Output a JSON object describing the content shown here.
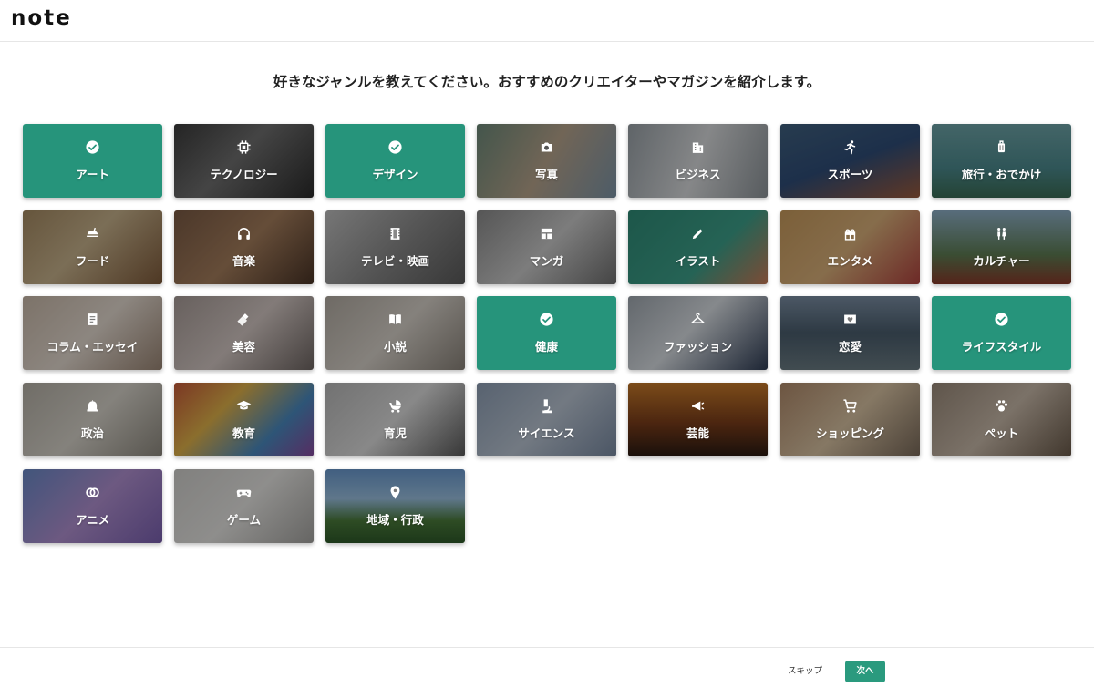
{
  "app": {
    "logo": "note"
  },
  "heading": "好きなジャンルを教えてください。おすすめのクリエイターやマガジンを紹介します。",
  "genres": [
    {
      "label": "アート",
      "icon": "check-icon",
      "selected": true,
      "bg": "#26947b"
    },
    {
      "label": "テクノロジー",
      "icon": "chip-icon",
      "selected": false,
      "bg": "linear-gradient(135deg,#3b3b3b,#6f6f6f 45%,#2b2b2b)"
    },
    {
      "label": "デザイン",
      "icon": "check-icon",
      "selected": true,
      "bg": "#26947b"
    },
    {
      "label": "写真",
      "icon": "camera-icon",
      "selected": false,
      "bg": "linear-gradient(120deg,#6d8a7a,#b7a48c 50%,#7d95a8)"
    },
    {
      "label": "ビジネス",
      "icon": "building-icon",
      "selected": false,
      "bg": "linear-gradient(110deg,#9aa2a8,#d8dadc 50%,#8d9499)"
    },
    {
      "label": "スポーツ",
      "icon": "runner-icon",
      "selected": false,
      "bg": "linear-gradient(160deg,#40617f,#2f4d78 50%,#9b5a3c)"
    },
    {
      "label": "旅行・おでかけ",
      "icon": "luggage-icon",
      "selected": false,
      "bg": "linear-gradient(180deg,#6ea4a8,#4c8a8e 60%,#3b6d55)"
    },
    {
      "label": "フード",
      "icon": "food-icon",
      "selected": false,
      "bg": "linear-gradient(135deg,#a58a62,#c7b28c 45%,#7e5a3a)"
    },
    {
      "label": "音楽",
      "icon": "headphones-icon",
      "selected": false,
      "bg": "linear-gradient(135deg,#7a5a44,#a47d5c 50%,#4a3426)"
    },
    {
      "label": "テレビ・映画",
      "icon": "film-icon",
      "selected": false,
      "bg": "linear-gradient(135deg,#bfbfbf,#8a8a8a 50%,#5a5a5a)"
    },
    {
      "label": "マンガ",
      "icon": "manga-icon",
      "selected": false,
      "bg": "linear-gradient(135deg,#8a8a8a,#c9c9c9 50%,#6f6f6f)"
    },
    {
      "label": "イラスト",
      "icon": "pencil-icon",
      "selected": false,
      "bg": "linear-gradient(135deg,#2f8c77,#3da08a 60%,#c97a56)"
    },
    {
      "label": "エンタメ",
      "icon": "gift-icon",
      "selected": false,
      "bg": "linear-gradient(135deg,#c79a5c,#d9b07a 50%,#b0433f)"
    },
    {
      "label": "カルチャー",
      "icon": "family-icon",
      "selected": false,
      "bg": "linear-gradient(180deg,#8fb0c8,#5e7d53 60%,#8a3a2a)"
    },
    {
      "label": "コラム・エッセイ",
      "icon": "document-icon",
      "selected": false,
      "bg": "linear-gradient(135deg,#c9b9a9,#e3d9cf 50%,#9a8574)"
    },
    {
      "label": "美容",
      "icon": "lipstick-icon",
      "selected": false,
      "bg": "linear-gradient(135deg,#a89c98,#d3c7c3 50%,#6f6663)"
    },
    {
      "label": "小説",
      "icon": "book-icon",
      "selected": false,
      "bg": "linear-gradient(135deg,#b3aca3,#d7d1c9 50%,#8a837a)"
    },
    {
      "label": "健康",
      "icon": "check-icon",
      "selected": true,
      "bg": "#26947b"
    },
    {
      "label": "ファッション",
      "icon": "hanger-icon",
      "selected": false,
      "bg": "linear-gradient(135deg,#a0a8b0,#d8dde2 45%,#2f3d55)"
    },
    {
      "label": "恋愛",
      "icon": "heart-mail-icon",
      "selected": false,
      "bg": "linear-gradient(180deg,#7b8ea3,#4a5d6d 50%,#6a7b82)"
    },
    {
      "label": "ライフスタイル",
      "icon": "check-icon",
      "selected": true,
      "bg": "#26947b"
    },
    {
      "label": "政治",
      "icon": "capitol-icon",
      "selected": false,
      "bg": "linear-gradient(135deg,#b5b0a6,#d6d2c9 50%,#8e897f)"
    },
    {
      "label": "教育",
      "icon": "graduation-cap-icon",
      "selected": false,
      "bg": "linear-gradient(135deg,#c85a3a,#e0b24a 35%,#4a8ac0 70%,#8a4aa0)"
    },
    {
      "label": "育児",
      "icon": "stroller-icon",
      "selected": false,
      "bg": "linear-gradient(135deg,#b8b8b8,#dcdcdc 50%,#5a5a5a)"
    },
    {
      "label": "サイエンス",
      "icon": "microscope-icon",
      "selected": false,
      "bg": "linear-gradient(135deg,#8e9fb5,#b9c4d2 50%,#7a8ba3)"
    },
    {
      "label": "芸能",
      "icon": "megaphone-icon",
      "selected": false,
      "bg": "linear-gradient(180deg,#c77a2a,#7a3d1a 55%,#2a1a12)"
    },
    {
      "label": "ショッピング",
      "icon": "cart-icon",
      "selected": false,
      "bg": "linear-gradient(135deg,#b08a6a,#d8c2a2 50%,#7a6a5a)"
    },
    {
      "label": "ペット",
      "icon": "paw-icon",
      "selected": false,
      "bg": "linear-gradient(135deg,#9a8a7a,#c7b8a8 50%,#6a5a4a)"
    },
    {
      "label": "アニメ",
      "icon": "rings-icon",
      "selected": false,
      "bg": "linear-gradient(135deg,#6a8ac8,#b090d0 50%,#7a60b0)"
    },
    {
      "label": "ゲーム",
      "icon": "gamepad-icon",
      "selected": false,
      "bg": "linear-gradient(135deg,#d0cfcc,#e6e5e2 50%,#a5a4a1)"
    },
    {
      "label": "地域・行政",
      "icon": "pin-icon",
      "selected": false,
      "bg": "linear-gradient(180deg,#6a9ad0,#9ac0e0 40%,#4a7a3a 70%,#2e5a2a)"
    }
  ],
  "footer": {
    "skip_label": "スキップ",
    "next_label": "次へ"
  },
  "colors": {
    "accent": "#26947b",
    "next_button": "#2a9a7e"
  }
}
